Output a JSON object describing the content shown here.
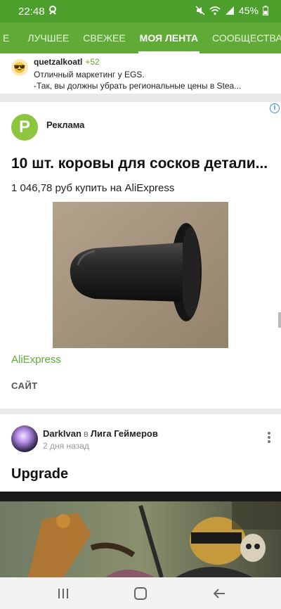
{
  "status": {
    "time": "22:48",
    "battery": "45%",
    "app_icon": "steam-notification-icon",
    "icons": [
      "mute-icon",
      "wifi-icon",
      "signal-icon",
      "battery-icon"
    ]
  },
  "tabs": [
    "Е",
    "ЛУЧШЕЕ",
    "СВЕЖЕЕ",
    "МОЯ ЛЕНТА",
    "СООБЩЕСТВА"
  ],
  "active_tab": "МОЯ ЛЕНТА",
  "comment": {
    "author": "quetzalkoatl",
    "rating": "+52",
    "line1": "Отличный маркетинг у EGS.",
    "line2": "-Так, вы должны убрать региональные цены в Stea..."
  },
  "ad": {
    "logo_letter": "P",
    "label": "Реклама",
    "title": "10 шт. коровы для сосков детали...",
    "price": "1 046,78 руб купить на AliExpress",
    "source": "AliExpress",
    "site_button": "САЙТ",
    "info_icon": "i"
  },
  "post": {
    "author": "DarkIvan",
    "in": "в",
    "community": "Лига Геймеров",
    "date": "2 дня назад",
    "title": "Upgrade"
  },
  "colors": {
    "brand_green": "#5fab35",
    "status_green": "#4c9f2b"
  }
}
